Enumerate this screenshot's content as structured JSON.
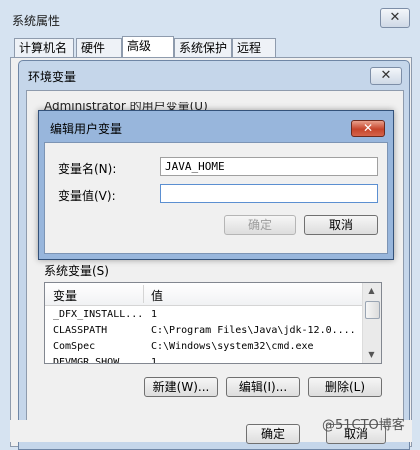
{
  "outer": {
    "title": "系统属性",
    "close": "✕",
    "tabs": [
      "计算机名",
      "硬件",
      "高级",
      "系统保护",
      "远程"
    ]
  },
  "env": {
    "title": "环境变量",
    "close": "✕",
    "user_vars_label_partial": "Administrator 的用户变量(U)",
    "system_vars_label": "系统变量(S)",
    "columns": [
      "变量",
      "值"
    ],
    "rows": [
      [
        "_DFX_INSTALL...",
        "1"
      ],
      [
        "CLASSPATH",
        "C:\\Program Files\\Java\\jdk-12.0...."
      ],
      [
        "ComSpec",
        "C:\\Windows\\system32\\cmd.exe"
      ],
      [
        "DEVMGR_SHOW_...",
        "1"
      ]
    ],
    "buttons": {
      "new": "新建(W)...",
      "edit": "编辑(I)...",
      "delete": "删除(L)"
    },
    "footer": {
      "ok": "确定",
      "cancel": "取消"
    }
  },
  "edit_dialog": {
    "title": "编辑用户变量",
    "close": "✕",
    "name_label": "变量名(N):",
    "name_value": "JAVA_HOME",
    "value_label": "变量值(V):",
    "value_value": "",
    "ok": "确定",
    "cancel": "取消"
  },
  "watermark": "@51CTO博客",
  "colors": {
    "titlebar": "#c5d6ea",
    "active_frame": "#98b6dc",
    "close_red": "#c6452b"
  }
}
